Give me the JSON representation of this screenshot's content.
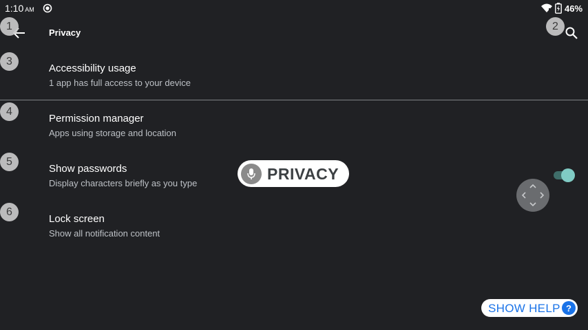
{
  "status_bar": {
    "time": "1:10",
    "ampm": "AM",
    "battery_percent": "46%"
  },
  "app_bar": {
    "title": "Privacy"
  },
  "settings": [
    {
      "title": "Accessibility usage",
      "summary": "1 app has full access to your device"
    },
    {
      "title": "Permission manager",
      "summary": "Apps using storage and location"
    },
    {
      "title": "Show passwords",
      "summary": "Display characters briefly as you type",
      "toggle_on": true
    },
    {
      "title": "Lock screen",
      "summary": "Show all notification content"
    }
  ],
  "badges": [
    "1",
    "2",
    "3",
    "4",
    "5",
    "6"
  ],
  "voice_overlay": {
    "text": "PRIVACY"
  },
  "help": {
    "label": "SHOW HELP",
    "icon_text": "?"
  },
  "colors": {
    "background": "#202124",
    "accent_toggle": "#80cbc4",
    "help_blue": "#1a73e8"
  },
  "icons": {
    "back": "arrow-left-icon",
    "search": "search-icon",
    "sync": "sync-icon",
    "wifi": "wifi-icon",
    "battery": "battery-charging-icon",
    "mic": "mic-icon",
    "dpad": "dpad-icon"
  }
}
